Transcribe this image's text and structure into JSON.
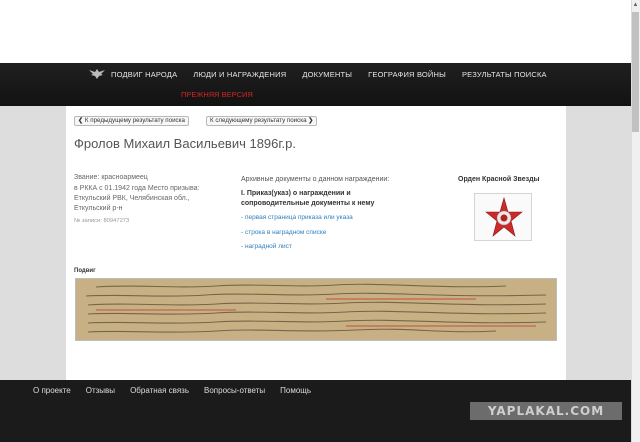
{
  "nav": {
    "items": [
      "ПОДВИГ НАРОДА",
      "ЛЮДИ И НАГРАЖДЕНИЯ",
      "ДОКУМЕНТЫ",
      "ГЕОГРАФИЯ ВОЙНЫ",
      "РЕЗУЛЬТАТЫ ПОИСКА"
    ],
    "old_version": "ПРЕЖНЯЯ ВЕРСИЯ"
  },
  "pager": {
    "prev": "К предыдущему результату поиска",
    "next": "К следующему результату поиска"
  },
  "person": {
    "name": "Фролов Михаил Васильевич 1896г.р.",
    "rank": "Звание: красноармеец",
    "service_1": "в РККА с 01.1942 года Место призыва:",
    "service_2": "Еткульский РВК, Челябинская обл.,",
    "service_3": "Еткульский р-н",
    "record": "№ записи: 80947273"
  },
  "archive": {
    "heading": "Архивные документы о данном награждении:",
    "title_1": "I. Приказ(указ) о награждении и",
    "title_2": "сопроводительные документы к нему",
    "links": [
      "- первая страница приказа или указа",
      "- строка в наградном списке",
      "- наградной лист"
    ]
  },
  "award": {
    "name": "Орден Красной Звезды",
    "colors": {
      "star": "#cc2a2a",
      "center": "#eeeeee"
    }
  },
  "feat": {
    "label": "Подвиг"
  },
  "footer": {
    "items": [
      "О проекте",
      "Отзывы",
      "Обратная связь",
      "Вопросы-ответы",
      "Помощь"
    ],
    "watermark": "YAPLAKAL.COM"
  },
  "colors": {
    "navbar": "#1a1a1a",
    "old_version": "#d12525",
    "link": "#2e7fbf"
  }
}
